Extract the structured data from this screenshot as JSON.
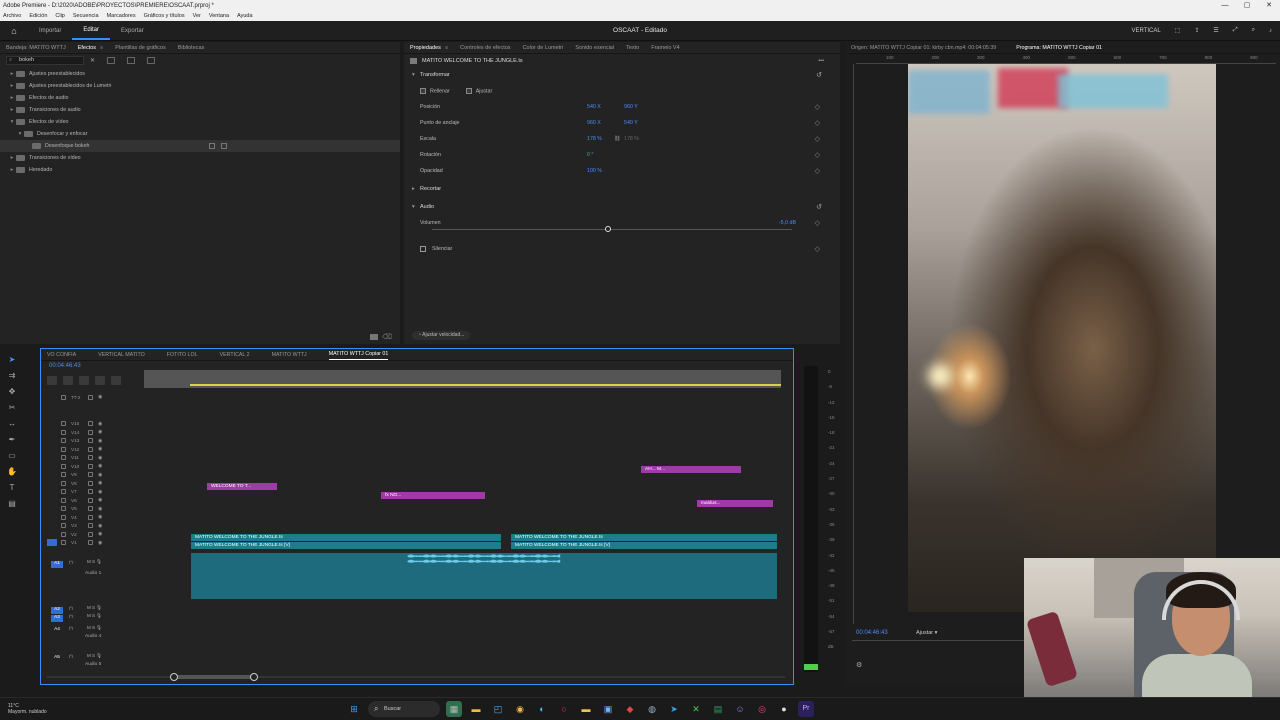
{
  "window": {
    "title": "Adobe Premiere - D:\\2020\\ADOBE\\PROYECTOS\\PREMIERE\\OSCAAT.prproj *",
    "controls": [
      "—",
      "▢",
      "✕"
    ]
  },
  "menu": [
    "Archivo",
    "Edición",
    "Clip",
    "Secuencia",
    "Marcadores",
    "Gráficos y títulos",
    "Ver",
    "Ventana",
    "Ayuda"
  ],
  "workspace": {
    "tabs": [
      "Importar",
      "Editar",
      "Exportar"
    ],
    "active_tab": "Editar",
    "project_title": "OSCAAT - Editado",
    "workspace_name": "VERTICAL"
  },
  "effects_panel": {
    "tabs": [
      "Bandeja: MATITO WTTJ",
      "Efectos",
      "Plantillas de gráficos",
      "Bibliotecas"
    ],
    "active_tab": "Efectos",
    "search_value": "bokeh",
    "tree": [
      {
        "label": "Ajustes preestablecidos",
        "depth": 0,
        "expanded": false
      },
      {
        "label": "Ajustes preestablecidos de Lumetri",
        "depth": 0,
        "expanded": false
      },
      {
        "label": "Efectos de audio",
        "depth": 0,
        "expanded": false
      },
      {
        "label": "Transiciones de audio",
        "depth": 0,
        "expanded": false
      },
      {
        "label": "Efectos de vídeo",
        "depth": 0,
        "expanded": true
      },
      {
        "label": "Desenfocar y enfocar",
        "depth": 1,
        "expanded": true
      },
      {
        "label": "Desenfoque bokeh",
        "depth": 2,
        "expanded": false,
        "selected": true
      },
      {
        "label": "Transiciones de vídeo",
        "depth": 0,
        "expanded": false
      },
      {
        "label": "Heredado",
        "depth": 0,
        "expanded": false
      }
    ]
  },
  "properties_panel": {
    "tabs": [
      "Propiedades",
      "Controles de efectos",
      "Color de Lumetri",
      "Sonido esencial",
      "Texto",
      "Frameio V4"
    ],
    "active_tab": "Propiedades",
    "clip_name": "MATITO WELCOME TO THE JUNGLE.ts",
    "transform_label": "Transformar",
    "fill_label": "Rellenar",
    "fit_label": "Ajustar",
    "position": {
      "label": "Posición",
      "x": "540 X",
      "y": "960 Y"
    },
    "anchor": {
      "label": "Punto de anclaje",
      "x": "960 X",
      "y": "540 Y"
    },
    "scale": {
      "label": "Escala",
      "value": "178 %",
      "linked": "178 %"
    },
    "rotation": {
      "label": "Rotación",
      "value": "0 °"
    },
    "opacity": {
      "label": "Opacidad",
      "value": "100 %"
    },
    "crop_label": "Recortar",
    "audio_label": "Audio",
    "volume": {
      "label": "Volumen",
      "value": "-5,0 dB",
      "level": 0.49
    },
    "mute_label": "Silenciar",
    "speed_button": "Ajustar velocidad..."
  },
  "monitor": {
    "tabs": [
      "Origen: MATITO WTTJ Copiar 01: kirby cbn.mp4: 00:04:05:39",
      "Programa: MATITO WTTJ Copiar 01"
    ],
    "active_tab": "Programa: MATITO WTTJ Copiar 01",
    "timecode": "00:04:46:43",
    "fit": "Ajustar",
    "ruler": [
      "100",
      "200",
      "300",
      "400",
      "500",
      "600",
      "700",
      "800",
      "900",
      "1000"
    ]
  },
  "timeline": {
    "tabs": [
      "VO CONFIA",
      "VERTICAL MATITO",
      "FOTITO LOL",
      "VERTICAL 2",
      "MATITO WTTJ",
      "MATITO WTTJ Copiar 01"
    ],
    "active_tab": "MATITO WTTJ Copiar 01",
    "timecode": "00:04:46:43",
    "video_tracks": [
      "TT-2",
      "V15",
      "V14",
      "V13",
      "V12",
      "V11",
      "V10",
      "V9",
      "V8",
      "V7",
      "V6",
      "V5",
      "V4",
      "V3",
      "V2",
      "V1"
    ],
    "audio_tracks": [
      {
        "tag": "A1",
        "name": "Audio 1"
      },
      {
        "tag": "A2",
        "name": ""
      },
      {
        "tag": "A3",
        "name": ""
      },
      {
        "tag": "A4",
        "name": "Audio 4"
      },
      {
        "tag": "A5",
        "name": "Audio 5"
      }
    ],
    "clips": [
      {
        "label": "WELCOME TO T...",
        "color": "pink"
      },
      {
        "label": "fx  NO...",
        "color": "pink"
      },
      {
        "label": "AH...   M...",
        "color": "pink"
      },
      {
        "label": "maldus...",
        "color": "pink"
      },
      {
        "label": "MATITO WELCOME TO THE JUNGLE.ts",
        "color": "teal"
      },
      {
        "label": "MATITO WELCOME TO THE JUNGLE.ts [V]",
        "color": "teal"
      },
      {
        "label": "MATITO WELCOME TO THE JUNGLE.ts",
        "color": "teal"
      },
      {
        "label": "MATITO WELCOME TO THE JUNGLE.ts [V]",
        "color": "teal"
      }
    ]
  },
  "meter": {
    "scale": [
      "0",
      "-6",
      "-12",
      "-15",
      "-18",
      "-21",
      "-24",
      "-27",
      "-30",
      "-33",
      "-36",
      "-39",
      "-42",
      "-45",
      "-48",
      "-51",
      "-54",
      "-57",
      "dB"
    ]
  },
  "taskbar": {
    "weather_temp": "11°C",
    "weather_desc": "Mayorm. nublado",
    "search_placeholder": "Buscar"
  }
}
